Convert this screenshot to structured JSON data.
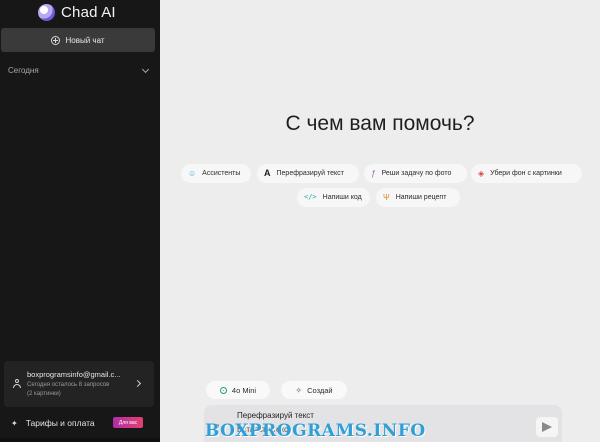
{
  "sidebar": {
    "brand": "Chad AI",
    "new_chat_label": "Новый чат",
    "section_today": "Сегодня",
    "account": {
      "email": "boxprogramsinfo@gmail.c...",
      "quota": "Сегодня осталось 8 запросов",
      "images": "(2 картинки)"
    },
    "plans_label": "Тарифы и оплата",
    "plans_badge": "Для вас"
  },
  "main": {
    "headline": "С чем вам помочь?",
    "suggestions": [
      {
        "label": "Ассистенты",
        "icon": "assistant-icon"
      },
      {
        "label": "Перефразируй текст",
        "icon": "font-icon"
      },
      {
        "label": "Реши задачу по фото",
        "icon": "math-icon"
      },
      {
        "label": "Убери фон с картинки",
        "icon": "image-icon"
      },
      {
        "label": "Напиши код",
        "icon": "code-icon"
      },
      {
        "label": "Напиши рецепт",
        "icon": "recipe-icon"
      }
    ],
    "model_label": "4o Mini",
    "create_label": "Создай",
    "composer": {
      "line1": "Перефразируй текст",
      "line2": "Вставьте текст"
    }
  },
  "watermark": "BOXPROGRAMS.INFO"
}
